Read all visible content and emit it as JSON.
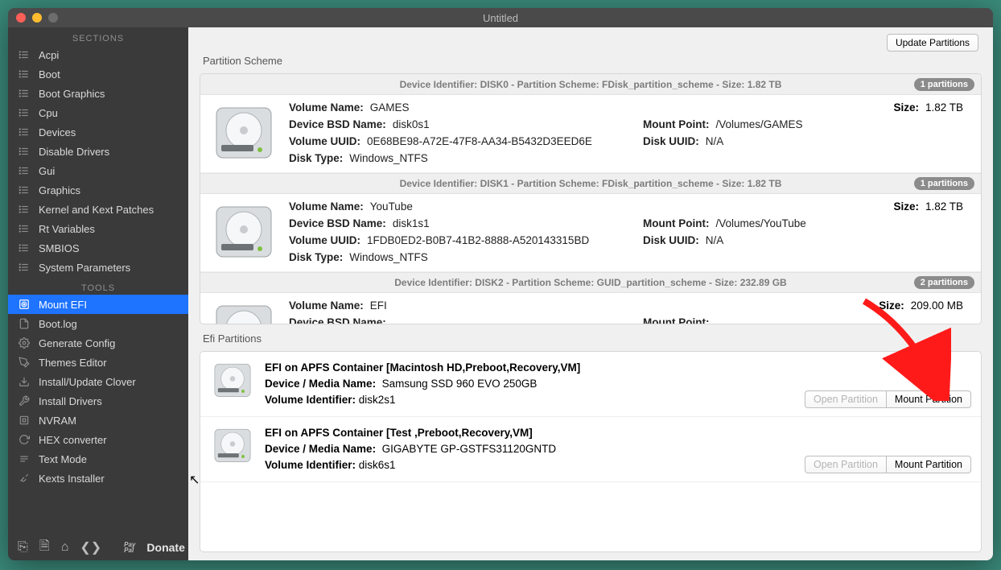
{
  "titlebar": {
    "title": "Untitled"
  },
  "sidebar": {
    "sections_label": "SECTIONS",
    "tools_label": "TOOLS",
    "sections": [
      {
        "icon": "list",
        "label": "Acpi"
      },
      {
        "icon": "list",
        "label": "Boot"
      },
      {
        "icon": "list",
        "label": "Boot Graphics"
      },
      {
        "icon": "list",
        "label": "Cpu"
      },
      {
        "icon": "list",
        "label": "Devices"
      },
      {
        "icon": "list",
        "label": "Disable Drivers"
      },
      {
        "icon": "list",
        "label": "Gui"
      },
      {
        "icon": "list",
        "label": "Graphics"
      },
      {
        "icon": "list",
        "label": "Kernel and Kext Patches"
      },
      {
        "icon": "list",
        "label": "Rt Variables"
      },
      {
        "icon": "list",
        "label": "SMBIOS"
      },
      {
        "icon": "list",
        "label": "System Parameters"
      }
    ],
    "tools": [
      {
        "icon": "disk",
        "label": "Mount EFI",
        "selected": true
      },
      {
        "icon": "file",
        "label": "Boot.log"
      },
      {
        "icon": "gear",
        "label": "Generate Config"
      },
      {
        "icon": "brush",
        "label": "Themes Editor"
      },
      {
        "icon": "download",
        "label": "Install/Update Clover"
      },
      {
        "icon": "wrench",
        "label": "Install Drivers"
      },
      {
        "icon": "chip",
        "label": "NVRAM"
      },
      {
        "icon": "refresh",
        "label": "HEX converter"
      },
      {
        "icon": "text",
        "label": "Text Mode"
      },
      {
        "icon": "plug",
        "label": "Kexts Installer"
      }
    ],
    "donate": "Donate"
  },
  "main": {
    "update_button": "Update Partitions",
    "partition_scheme_title": "Partition Scheme",
    "efi_title": "Efi Partitions",
    "labels": {
      "volume_name": "Volume Name:",
      "device_bsd": "Device BSD Name:",
      "volume_uuid": "Volume UUID:",
      "disk_type": "Disk Type:",
      "mount_point": "Mount Point:",
      "disk_uuid": "Disk UUID:",
      "size": "Size:",
      "device_media": "Device / Media Name:",
      "volume_id": "Volume Identifier:"
    },
    "devices": [
      {
        "header": "Device Identifier: DISK0 - Partition Scheme: FDisk_partition_scheme - Size: 1.82 TB",
        "badge": "1 partitions",
        "part": {
          "volume_name": "GAMES",
          "bsd": "disk0s1",
          "uuid": "0E68BE98-A72E-47F8-AA34-B5432D3EED6E",
          "type": "Windows_NTFS",
          "mount": "/Volumes/GAMES",
          "diskuuid": "N/A",
          "size": "1.82 TB"
        }
      },
      {
        "header": "Device Identifier: DISK1 - Partition Scheme: FDisk_partition_scheme - Size: 1.82 TB",
        "badge": "1 partitions",
        "part": {
          "volume_name": "YouTube",
          "bsd": "disk1s1",
          "uuid": "1FDB0ED2-B0B7-41B2-8888-A520143315BD",
          "type": "Windows_NTFS",
          "mount": "/Volumes/YouTube",
          "diskuuid": "N/A",
          "size": "1.82 TB"
        }
      },
      {
        "header": "Device Identifier: DISK2 - Partition Scheme: GUID_partition_scheme - Size: 232.89 GB",
        "badge": "2 partitions",
        "part": {
          "volume_name": "EFI",
          "bsd": "",
          "uuid": "",
          "type": "",
          "mount": "",
          "diskuuid": "",
          "size": "209.00 MB"
        }
      }
    ],
    "efi": [
      {
        "title": "EFI on APFS Container [Macintosh HD,Preboot,Recovery,VM]",
        "media": "Samsung SSD 960 EVO 250GB",
        "volid": "disk2s1",
        "open": "Open Partition",
        "mount": "Mount Partition"
      },
      {
        "title": "EFI on APFS Container [Test ,Preboot,Recovery,VM]",
        "media": "GIGABYTE GP-GSTFS31120GNTD",
        "volid": "disk6s1",
        "open": "Open Partition",
        "mount": "Mount Partition"
      }
    ]
  }
}
